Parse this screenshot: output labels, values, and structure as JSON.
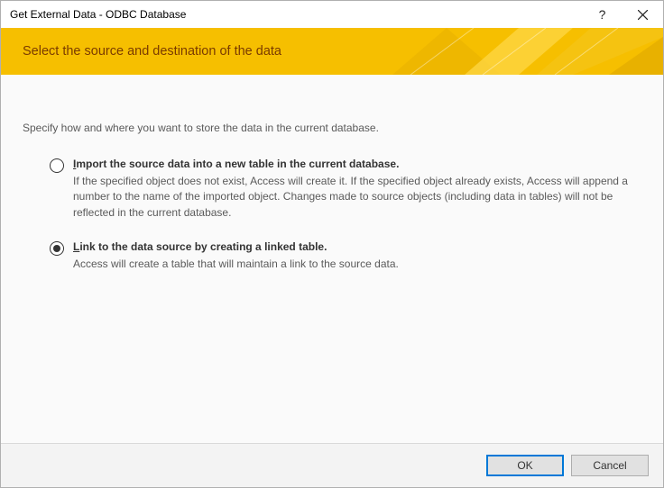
{
  "window": {
    "title": "Get External Data - ODBC Database"
  },
  "banner": {
    "heading": "Select the source and destination of the data"
  },
  "body": {
    "intro": "Specify how and where you want to store the data in the current database.",
    "options": [
      {
        "title_pre": "I",
        "title_rest": "mport the source data into a new table in the current database.",
        "desc": "If the specified object does not exist, Access will create it. If the specified object already exists, Access will append a number to the name of the imported object. Changes made to source objects (including data in tables) will not be reflected in the current database.",
        "selected": false
      },
      {
        "title_pre": "L",
        "title_rest": "ink to the data source by creating a linked table.",
        "desc": "Access will create a table that will maintain a link to the source data.",
        "selected": true
      }
    ]
  },
  "footer": {
    "ok": "OK",
    "cancel": "Cancel"
  }
}
